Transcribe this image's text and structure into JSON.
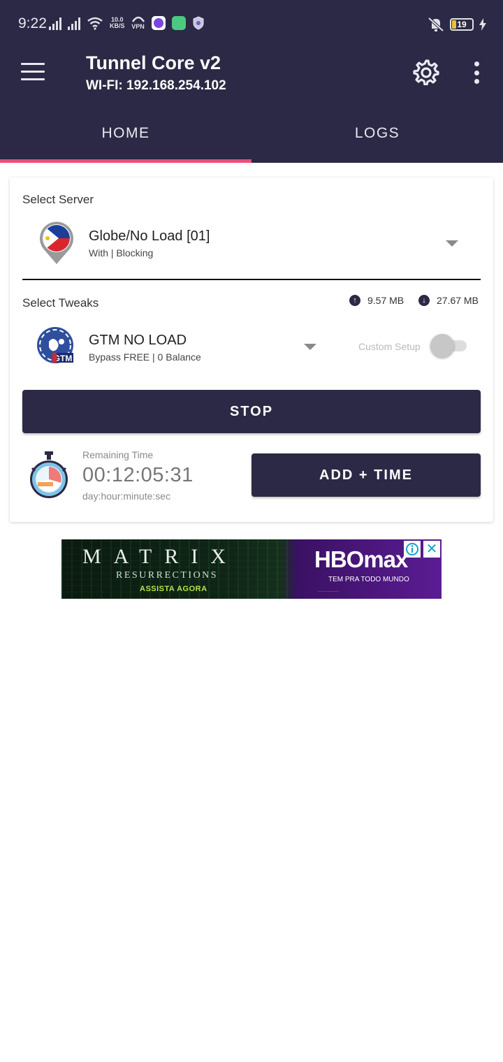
{
  "status_bar": {
    "time": "9:22",
    "speed_top": "10.0",
    "speed_unit": "KB/S",
    "vpn_label": "VPN",
    "battery": "19"
  },
  "app_bar": {
    "title": "Tunnel Core v2",
    "subtitle": "WI-FI: 192.168.254.102"
  },
  "tabs": [
    {
      "label": "HOME",
      "active": true
    },
    {
      "label": "LOGS",
      "active": false
    }
  ],
  "server": {
    "section_label": "Select Server",
    "name": "Globe/No Load [01]",
    "description": "With | Blocking"
  },
  "tweaks": {
    "section_label": "Select Tweaks",
    "upload": "9.57 MB",
    "download": "27.67 MB",
    "name": "GTM NO LOAD",
    "description": "Bypass FREE | 0 Balance",
    "custom_setup_label": "Custom Setup",
    "custom_setup_enabled": false
  },
  "actions": {
    "stop_label": "STOP",
    "add_time_label": "ADD + TIME"
  },
  "timer": {
    "label": "Remaining Time",
    "value": "00:12:05:31",
    "format": "day:hour:minute:sec"
  },
  "ad": {
    "title": "MATRIX",
    "subtitle": "RESURRECTIONS",
    "cta": "ASSISTA AGORA",
    "brand": "HBOmax",
    "tagline": "TEM PRA TODO MUNDO"
  },
  "colors": {
    "primary": "#2b2945",
    "tab_indicator": "#e94e7b"
  }
}
